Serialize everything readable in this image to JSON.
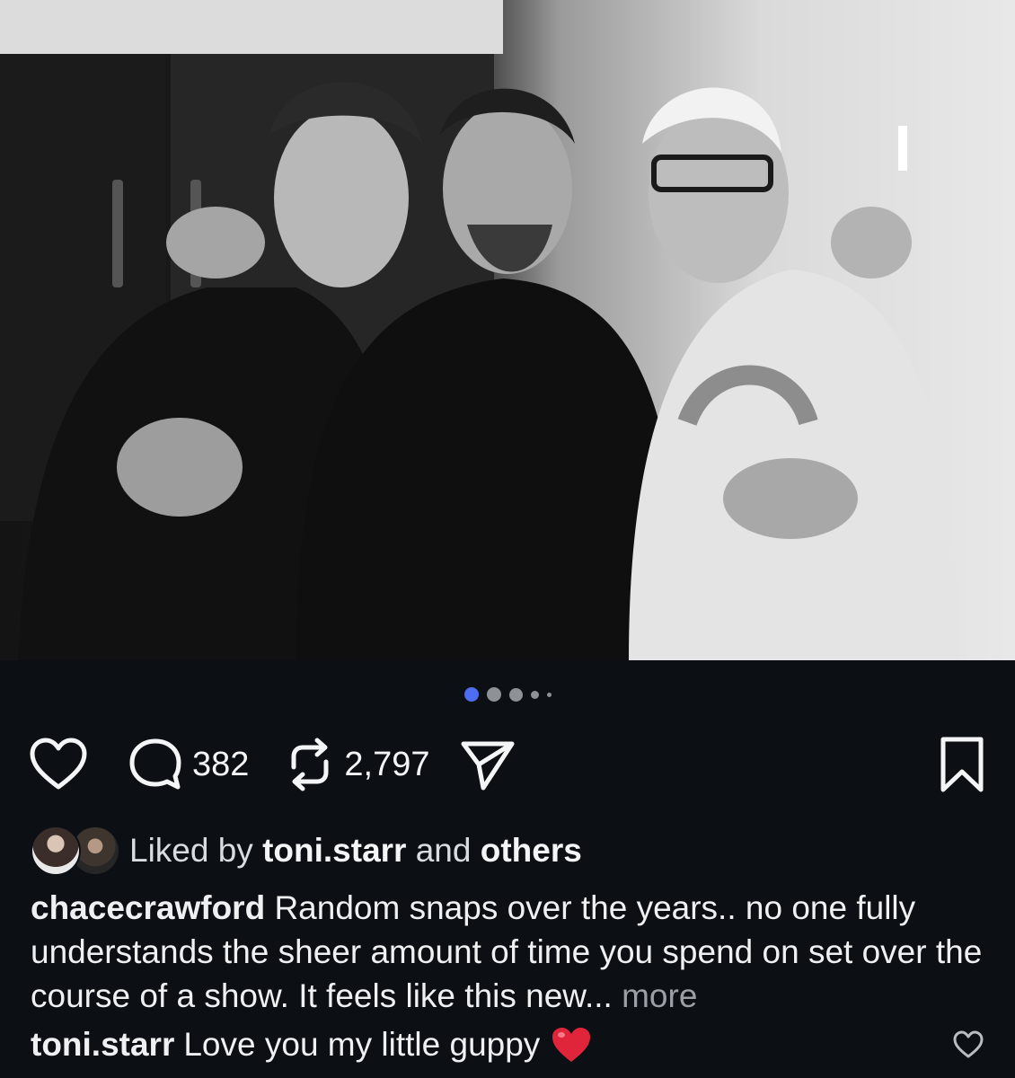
{
  "post": {
    "carousel": {
      "total": 5,
      "active_index": 0
    },
    "actions": {
      "like_icon": "heart-outline-icon",
      "comment_icon": "comment-bubble-icon",
      "comment_count": "382",
      "repost_icon": "repost-icon",
      "repost_count": "2,797",
      "share_icon": "send-icon",
      "save_icon": "bookmark-icon"
    },
    "liked_by": {
      "prefix": "Liked by",
      "user": "toni.starr",
      "joiner": "and",
      "others": "others"
    },
    "caption": {
      "username": "chacecrawford",
      "text": "Random snaps over the years.. no one fully understands the sheer amount of time you spend on set over the course of a show. It feels like this new...",
      "more_label": "more"
    },
    "comment": {
      "username": "toni.starr",
      "text": "Love you my little guppy",
      "emoji": "red-heart-emoji"
    }
  },
  "colors": {
    "background": "#0c0f14",
    "active_dot": "#4d6df2",
    "text": "#f3f5f7",
    "muted": "#9aa0a6",
    "emoji_heart": "#e0243a"
  }
}
